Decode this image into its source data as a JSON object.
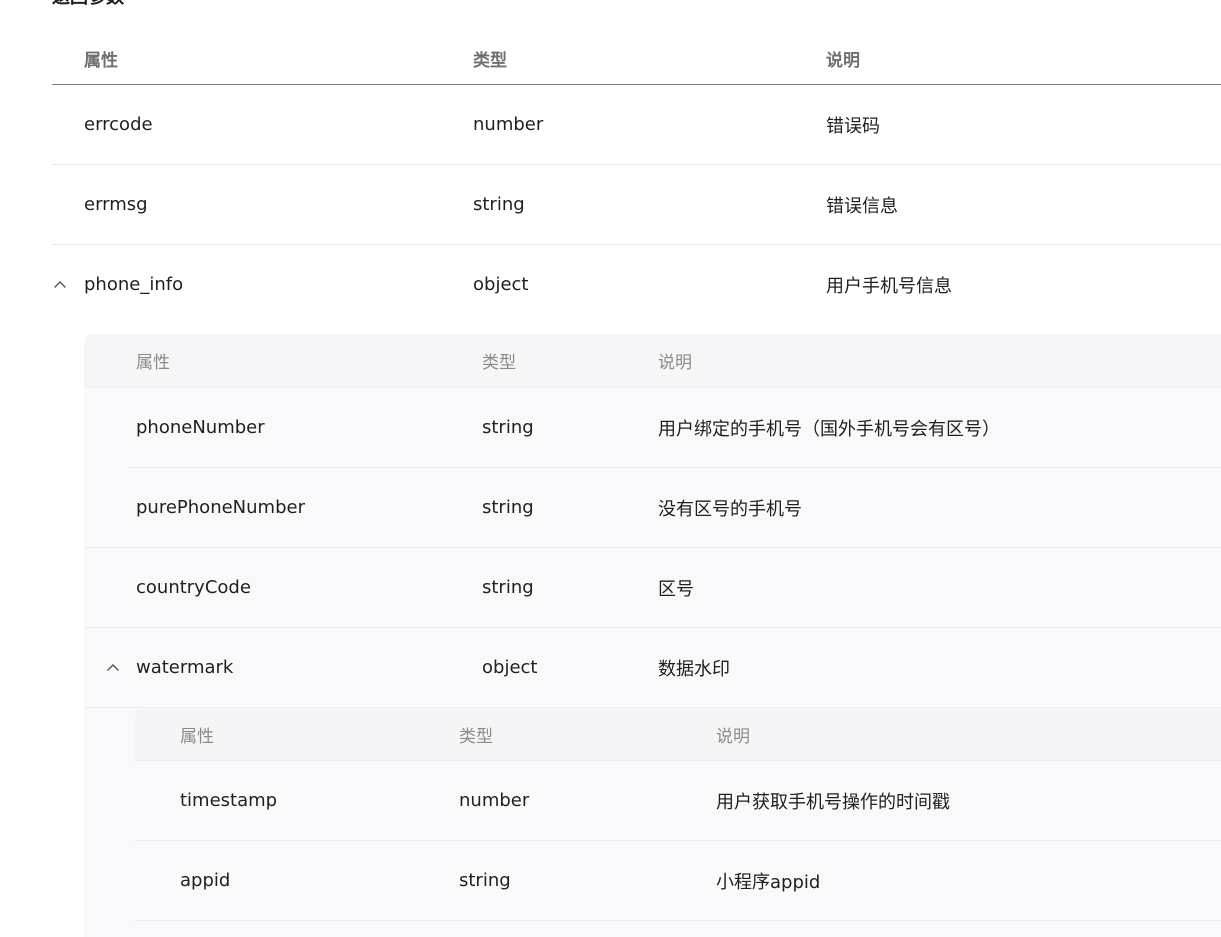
{
  "section_title": "返回参数",
  "columns": {
    "name": "属性",
    "type": "类型",
    "desc": "说明"
  },
  "top_rows": [
    {
      "name": "errcode",
      "type": "number",
      "desc": "错误码"
    },
    {
      "name": "errmsg",
      "type": "string",
      "desc": "错误信息"
    },
    {
      "name": "phone_info",
      "type": "object",
      "desc": "用户手机号信息",
      "expanded": true
    }
  ],
  "phone_info_rows": [
    {
      "name": "phoneNumber",
      "type": "string",
      "desc": "用户绑定的手机号（国外手机号会有区号）"
    },
    {
      "name": "purePhoneNumber",
      "type": "string",
      "desc": "没有区号的手机号"
    },
    {
      "name": "countryCode",
      "type": "string",
      "desc": "区号"
    },
    {
      "name": "watermark",
      "type": "object",
      "desc": "数据水印",
      "expanded": true
    }
  ],
  "watermark_rows": [
    {
      "name": "timestamp",
      "type": "number",
      "desc": "用户获取手机号操作的时间戳"
    },
    {
      "name": "appid",
      "type": "string",
      "desc": "小程序appid"
    }
  ],
  "icons": {
    "expand_toggle": "chevron-up-icon"
  },
  "colors": {
    "header_text": "#6f6f6f",
    "nested_header_text": "#8a8a8a",
    "nested_background": "#f9f9fb",
    "row_divider": "#e8e8e8"
  }
}
